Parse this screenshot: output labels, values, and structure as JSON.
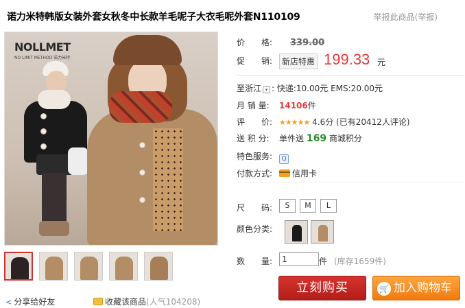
{
  "product": {
    "title": "诺力米特韩版女装外套女秋冬中长款羊毛呢子大衣毛呢外套N110109",
    "report_link": "举报此商品(举报)",
    "brand_logo": "NOLLMET",
    "brand_sub": "NO LIMIT METHOD  诺力米特"
  },
  "price": {
    "label": "价　　格:",
    "original": "339.00",
    "promo_label": "促　　销:",
    "promo_badge": "新店特惠",
    "promo_price": "199.33",
    "currency": "元"
  },
  "shipping": {
    "region": "至浙江",
    "arrow": "▾",
    "text": ": 快递:10.00元 EMS:20.00元"
  },
  "sales": {
    "label": "月 销 量:",
    "count": "14106",
    "unit": "件"
  },
  "rating": {
    "label": "评　　价:",
    "stars": "★★★★★",
    "text": "4.6分 (已有20412人评论)"
  },
  "points": {
    "label": "送 积 分:",
    "prefix": "单件送",
    "value": "169",
    "suffix": "商城积分"
  },
  "service": {
    "label": "特色服务:"
  },
  "payment": {
    "label": "付款方式:",
    "method": "信用卡"
  },
  "size": {
    "label": "尺　　码:",
    "options": [
      "S",
      "M",
      "L"
    ]
  },
  "color": {
    "label": "颜色分类:",
    "swatch_colors": [
      "#1a1a1a",
      "#b28d66"
    ]
  },
  "quantity": {
    "label": "数　　量:",
    "value": "1",
    "unit": "件",
    "stock": "(库存1659件)"
  },
  "actions": {
    "buy_now": "立刻购买",
    "add_to_cart": "加入购物车",
    "share": "分享给好友",
    "favorite": "收藏该商品",
    "popularity": "(人气104208)"
  },
  "thumbnails": [
    {
      "color": "#2a2225"
    },
    {
      "color": "#b28d66"
    },
    {
      "color": "#b28d66"
    },
    {
      "color": "#b28d66"
    },
    {
      "color": "#a87e58"
    }
  ]
}
